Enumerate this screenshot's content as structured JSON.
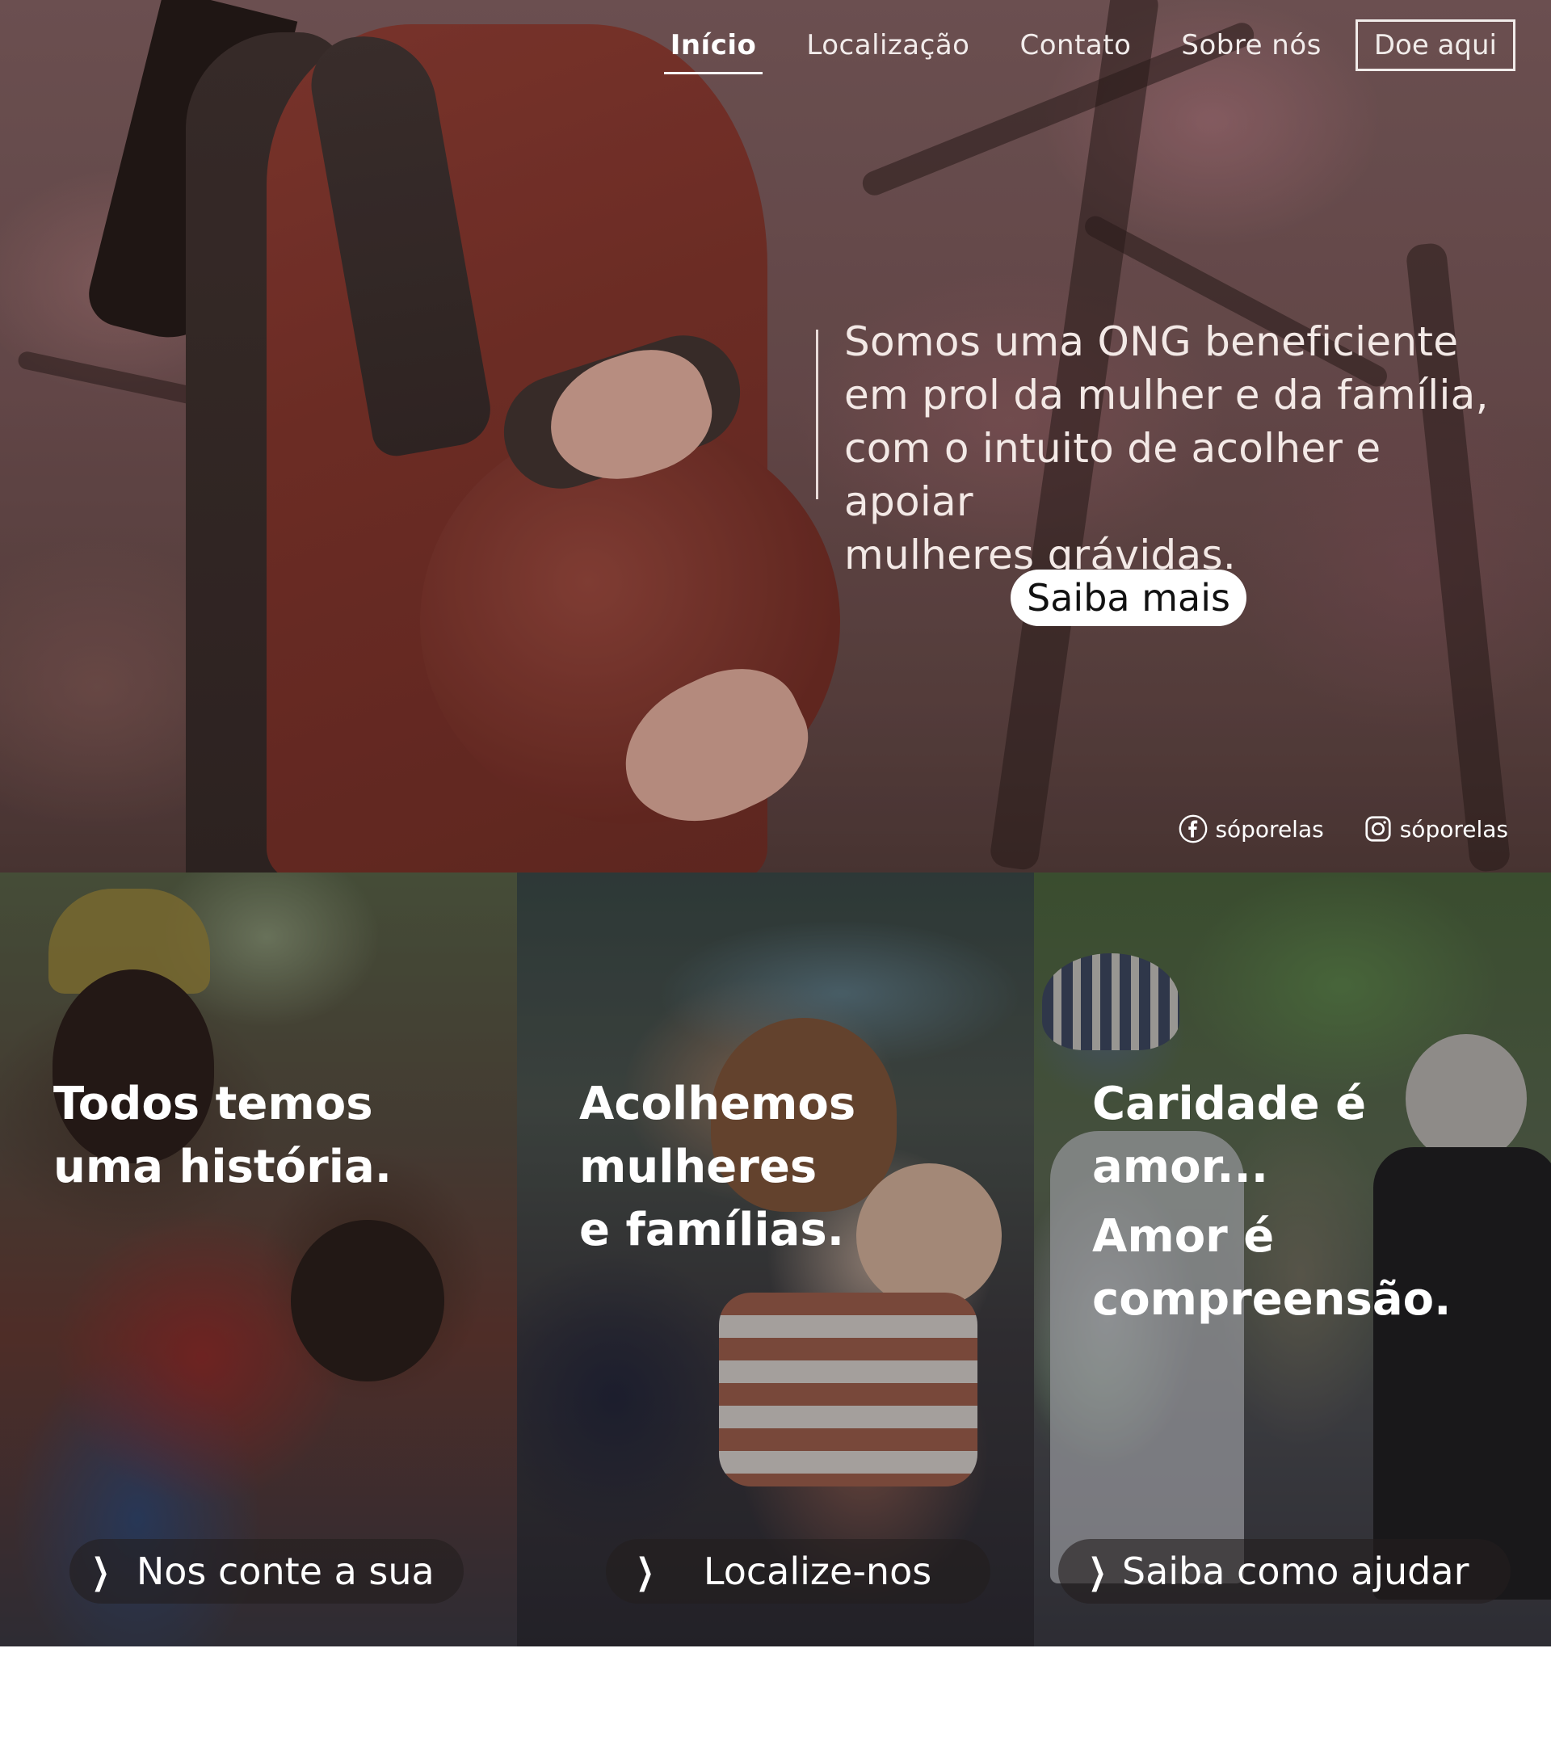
{
  "nav": {
    "items": [
      {
        "label": "Início",
        "active": true
      },
      {
        "label": "Localização",
        "active": false
      },
      {
        "label": "Contato",
        "active": false
      },
      {
        "label": "Sobre nós",
        "active": false
      }
    ],
    "donate_label": "Doe aqui"
  },
  "hero": {
    "lines": [
      "Somos uma ONG beneficiente",
      "em prol da mulher e da família,",
      "com o intuito de acolher e apoiar",
      "mulheres grávidas."
    ],
    "cta_label": "Saiba mais"
  },
  "socials": {
    "facebook": {
      "icon": "facebook-icon",
      "handle": "sóporelas"
    },
    "instagram": {
      "icon": "instagram-icon",
      "handle": "sóporelas"
    }
  },
  "cards": [
    {
      "title_lines": [
        "Todos temos",
        "uma história."
      ],
      "subtitle_lines": [],
      "link_label": "Nos conte a sua"
    },
    {
      "title_lines": [
        "Acolhemos",
        "mulheres",
        "e famílias."
      ],
      "subtitle_lines": [],
      "link_label": "Localize-nos"
    },
    {
      "title_lines": [
        "Caridade é",
        "amor..."
      ],
      "subtitle_lines": [
        "Amor é",
        "compreensão."
      ],
      "link_label": "Saiba como ajudar"
    }
  ],
  "colors": {
    "nav_text": "#f2eceb",
    "hero_text": "#f3e9e6",
    "cta_bg": "#ffffff",
    "cta_text": "#111111"
  }
}
